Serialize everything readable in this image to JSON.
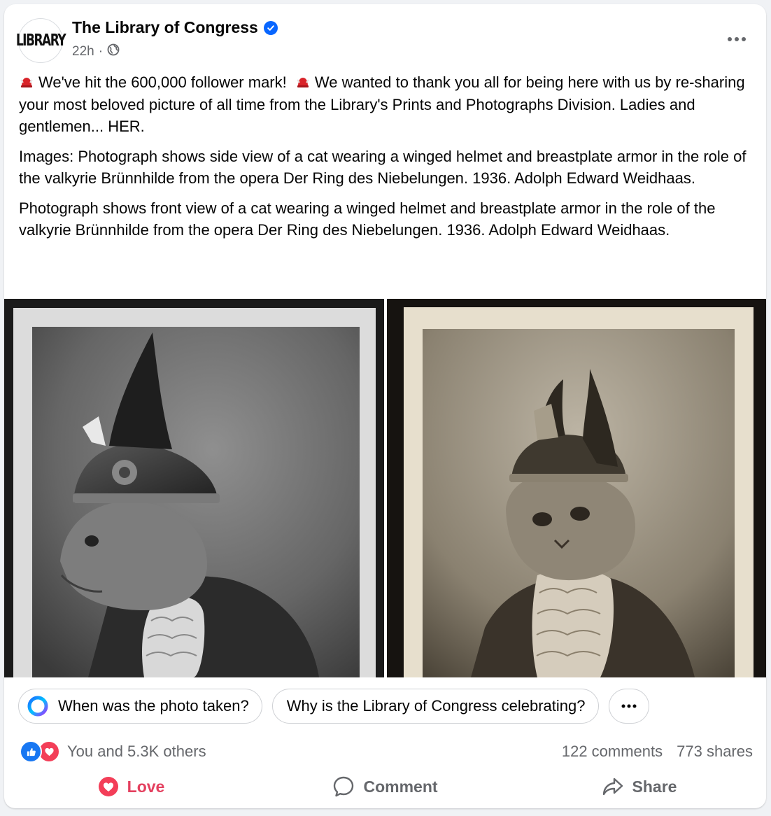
{
  "post": {
    "author": "The Library of Congress",
    "avatar_text": "LIBRARY",
    "timestamp": "22h",
    "separator": "·",
    "audience_icon": "globe-icon",
    "verified_icon": "verified-badge-icon",
    "more_icon": "more-horizontal-icon"
  },
  "text": {
    "p1_a": "We've hit the 600,000 follower mark!",
    "p1_b": "We wanted to thank you all for being here with us by re-sharing your most beloved picture of all time from the Library's Prints and Photographs Division. Ladies and gentlemen... HER.",
    "p2": "Images: Photograph shows side view of a cat wearing a winged helmet and breastplate armor in the role of the valkyrie Brünnhilde from the opera Der Ring des Niebelungen. 1936. Adolph Edward Weidhaas.",
    "p3": "Photograph shows front view of a cat wearing a winged helmet and breastplate armor in the role of the valkyrie Brünnhilde from the opera Der Ring des Niebelungen. 1936. Adolph Edward Weidhaas.",
    "emoji_icon": "viking-hat-emoji"
  },
  "suggestions": {
    "ai_icon": "meta-ai-ring-icon",
    "q1": "When was the photo taken?",
    "q2": "Why is the Library of Congress celebrating?",
    "more_icon": "more-horizontal-icon"
  },
  "stats": {
    "reactions_text": "You and 5.3K others",
    "comments": "122 comments",
    "shares": "773 shares"
  },
  "actions": {
    "love": "Love",
    "comment": "Comment",
    "share": "Share"
  },
  "colors": {
    "brand_blue": "#0866ff",
    "love_red": "#e4405f",
    "secondary_text": "#65676b"
  }
}
